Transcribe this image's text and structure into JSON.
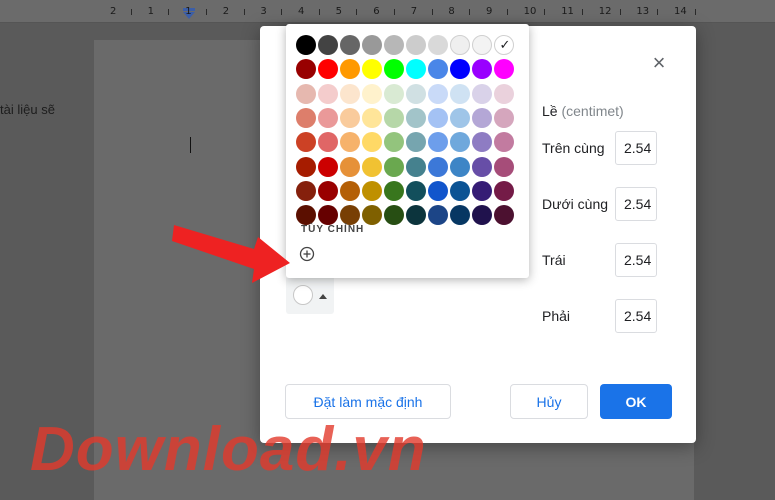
{
  "ruler": {
    "numbers": [
      "2",
      "1",
      "1",
      "2",
      "3",
      "4",
      "5",
      "6",
      "7",
      "8",
      "9",
      "10",
      "11",
      "12",
      "13",
      "14"
    ]
  },
  "document": {
    "visible_text": "tài liệu sẽ"
  },
  "dialog": {
    "close_icon": "close-icon",
    "margins": {
      "title": "Lề",
      "unit": "(centimet)",
      "fields": [
        {
          "label": "Trên cùng",
          "value": "2.54"
        },
        {
          "label": "Dưới cùng",
          "value": "2.54"
        },
        {
          "label": "Trái",
          "value": "2.54"
        },
        {
          "label": "Phải",
          "value": "2.54"
        }
      ]
    },
    "buttons": {
      "set_default": "Đặt làm mặc định",
      "cancel": "Hủy",
      "ok": "OK"
    },
    "page_color_selected": "#ffffff"
  },
  "palette": {
    "custom_label": "TÙY CHỈNH",
    "selected_index": 9,
    "checkmark": "✓",
    "rows": [
      [
        "#000000",
        "#434343",
        "#666666",
        "#999999",
        "#b7b7b7",
        "#cccccc",
        "#d9d9d9",
        "#efefef",
        "#f3f3f3",
        "#ffffff"
      ],
      [
        "#980000",
        "#ff0000",
        "#ff9900",
        "#ffff00",
        "#00ff00",
        "#00ffff",
        "#4a86e8",
        "#0000ff",
        "#9900ff",
        "#ff00ff"
      ],
      [
        "#e6b8af",
        "#f4cccc",
        "#fce5cd",
        "#fff2cc",
        "#d9ead3",
        "#d0e0e3",
        "#c9daf8",
        "#cfe2f3",
        "#d9d2e9",
        "#ead1dc"
      ],
      [
        "#dd7e6b",
        "#ea9999",
        "#f9cb9c",
        "#ffe599",
        "#b6d7a8",
        "#a2c4c9",
        "#a4c2f4",
        "#9fc5e8",
        "#b4a7d6",
        "#d5a6bd"
      ],
      [
        "#cc4125",
        "#e06666",
        "#f6b26b",
        "#ffd966",
        "#93c47d",
        "#76a5af",
        "#6d9eeb",
        "#6fa8dc",
        "#8e7cc3",
        "#c27ba0"
      ],
      [
        "#a61c00",
        "#cc0000",
        "#e69138",
        "#f1c232",
        "#6aa84f",
        "#45818e",
        "#3c78d8",
        "#3d85c6",
        "#674ea7",
        "#a64d79"
      ],
      [
        "#85200c",
        "#990000",
        "#b45f06",
        "#bf9000",
        "#38761d",
        "#134f5c",
        "#1155cc",
        "#0b5394",
        "#351c75",
        "#741b47"
      ],
      [
        "#5b0f00",
        "#660000",
        "#783f04",
        "#7f6000",
        "#274e13",
        "#0c343d",
        "#1c4587",
        "#073763",
        "#20124d",
        "#4c1130"
      ]
    ]
  },
  "watermark": {
    "text": "Download.vn",
    "color": "#e23a2c"
  },
  "arrow": {
    "color": "#ee2222"
  }
}
